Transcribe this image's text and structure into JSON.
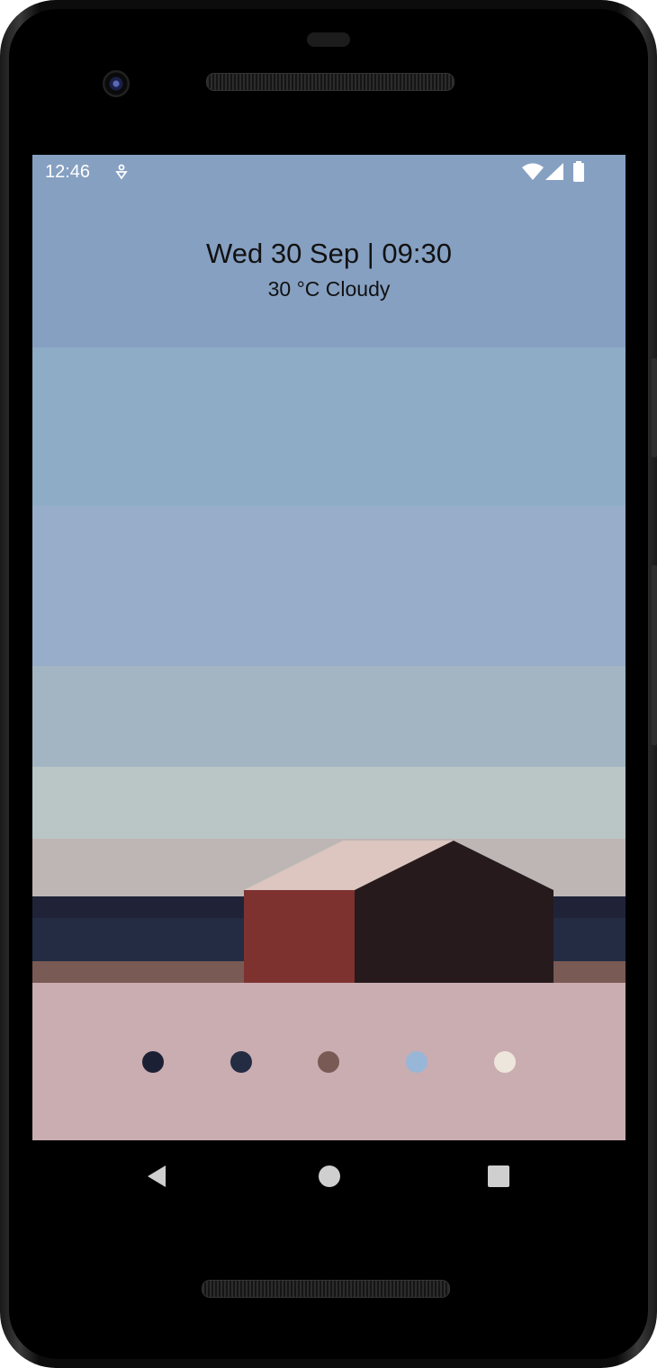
{
  "status_bar": {
    "time": "12:46",
    "icons": [
      "notification-icon",
      "wifi-icon",
      "signal-icon",
      "battery-icon"
    ]
  },
  "header": {
    "date_time": "Wed 30 Sep | 09:30",
    "weather": "30 °C Cloudy"
  },
  "palette": {
    "colors": [
      "#1c2034",
      "#232c42",
      "#7a5a55",
      "#98b6d8",
      "#ede6dc"
    ]
  },
  "wallpaper": {
    "bands": [
      "#86a0c2",
      "#8eacc6",
      "#97adca",
      "#a3b5c2",
      "#bac5c6",
      "#bdb6b5",
      "#202338",
      "#232c42",
      "#7a5a55",
      "#c9adb1"
    ]
  },
  "navigation": {
    "buttons": [
      "back-icon",
      "home-icon",
      "recents-icon"
    ]
  }
}
